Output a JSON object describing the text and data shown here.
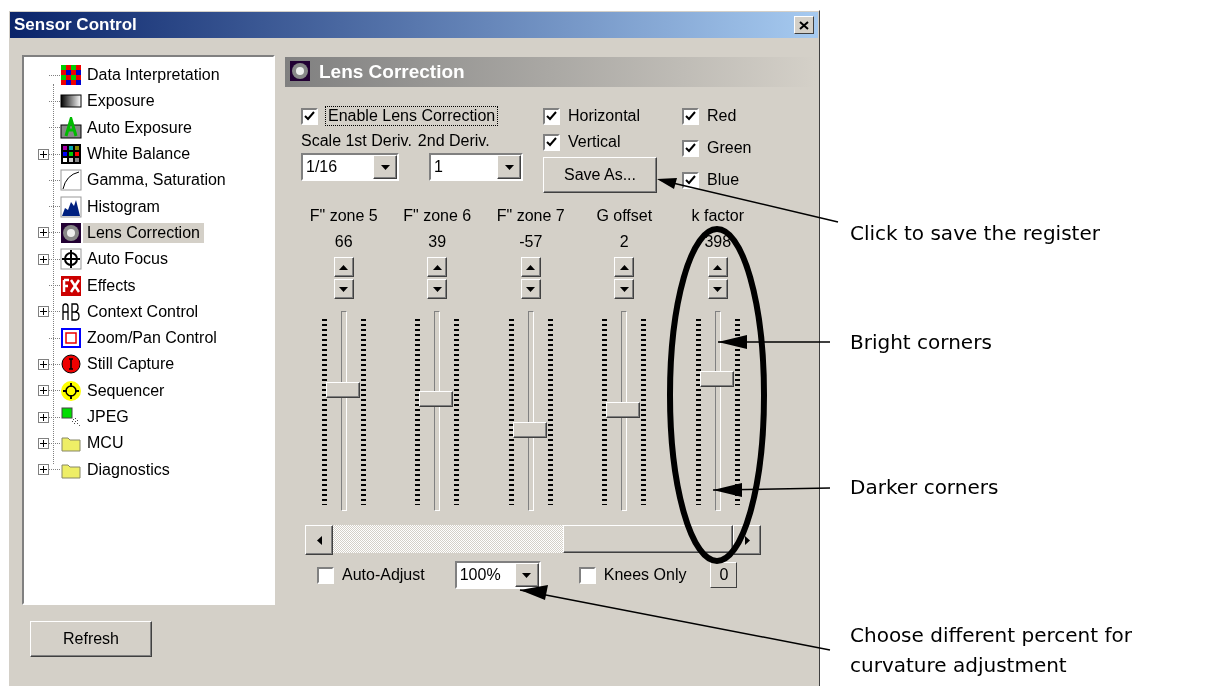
{
  "window": {
    "title": "Sensor Control"
  },
  "tree": {
    "items": [
      {
        "label": "Data Interpretation",
        "kind": "leaf",
        "selected": false
      },
      {
        "label": "Exposure",
        "kind": "leaf",
        "selected": false
      },
      {
        "label": "Auto Exposure",
        "kind": "leaf",
        "selected": false
      },
      {
        "label": "White Balance",
        "kind": "collapsed",
        "selected": false
      },
      {
        "label": "Gamma, Saturation",
        "kind": "leaf",
        "selected": false
      },
      {
        "label": "Histogram",
        "kind": "leaf",
        "selected": false
      },
      {
        "label": "Lens Correction",
        "kind": "collapsed",
        "selected": true
      },
      {
        "label": "Auto Focus",
        "kind": "collapsed",
        "selected": false
      },
      {
        "label": "Effects",
        "kind": "leaf",
        "selected": false
      },
      {
        "label": "Context Control",
        "kind": "collapsed",
        "selected": false
      },
      {
        "label": "Zoom/Pan Control",
        "kind": "leaf",
        "selected": false
      },
      {
        "label": "Still Capture",
        "kind": "collapsed",
        "selected": false
      },
      {
        "label": "Sequencer",
        "kind": "collapsed",
        "selected": false
      },
      {
        "label": "JPEG",
        "kind": "collapsed",
        "selected": false
      },
      {
        "label": "MCU",
        "kind": "collapsed",
        "selected": false
      },
      {
        "label": "Diagnostics",
        "kind": "collapsed",
        "selected": false
      }
    ]
  },
  "refresh_button": "Refresh",
  "panel": {
    "title": "Lens Correction",
    "enable": {
      "label": "Enable Lens Correction",
      "checked": true
    },
    "scale_label": "Scale 1st Deriv.",
    "second_label": "2nd Deriv.",
    "scale_dropdown": {
      "value": "1/16"
    },
    "second_dropdown": {
      "value": "1"
    },
    "directions": [
      {
        "label": "Horizontal",
        "checked": true
      },
      {
        "label": "Vertical",
        "checked": true
      }
    ],
    "save_button": "Save As...",
    "colors": [
      {
        "label": "Red",
        "checked": true
      },
      {
        "label": "Green",
        "checked": true
      },
      {
        "label": "Blue",
        "checked": true
      }
    ],
    "sliders": [
      {
        "label": "F\" zone 5",
        "value": "66",
        "level": 0.62
      },
      {
        "label": "F\" zone 6",
        "value": "39",
        "level": 0.57
      },
      {
        "label": "F\" zone 7",
        "value": "-57",
        "level": 0.4
      },
      {
        "label": "G offset",
        "value": "2",
        "level": 0.51
      },
      {
        "label": "k factor",
        "value": "398",
        "level": 0.68
      }
    ],
    "auto_adjust": {
      "label": "Auto-Adjust",
      "checked": false
    },
    "percent_dropdown": {
      "value": "100%"
    },
    "knees_only": {
      "label": "Knees Only",
      "checked": false
    },
    "knee_count": "0"
  },
  "annotations": [
    {
      "text": "Click to save the register"
    },
    {
      "text": "Bright corners"
    },
    {
      "text": "Darker corners"
    },
    {
      "text": "Choose different percent for curvature adjustment"
    }
  ]
}
